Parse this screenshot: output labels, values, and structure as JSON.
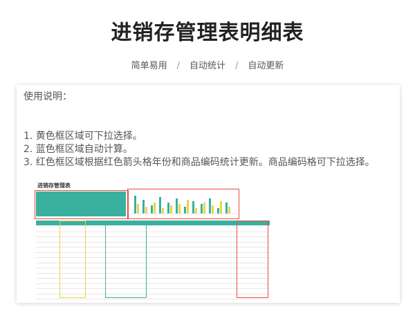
{
  "header": {
    "title": "进销存管理表明细表",
    "features": [
      "简单易用",
      "自动统计",
      "自动更新"
    ],
    "separator": "/"
  },
  "instructions": {
    "heading": "使用说明：",
    "items": [
      "1. 黄色框区域可下拉选择。",
      "2. 蓝色框区域自动计算。",
      "3. 红色框区域根据红色箭头格年份和商品编码统计更新。商品编码格可下拉选择。"
    ]
  },
  "sheet": {
    "title": "进销存管理表"
  },
  "colors": {
    "teal": "#3ab09e",
    "red": "#e74c3c",
    "yellow": "#e8d34a"
  }
}
